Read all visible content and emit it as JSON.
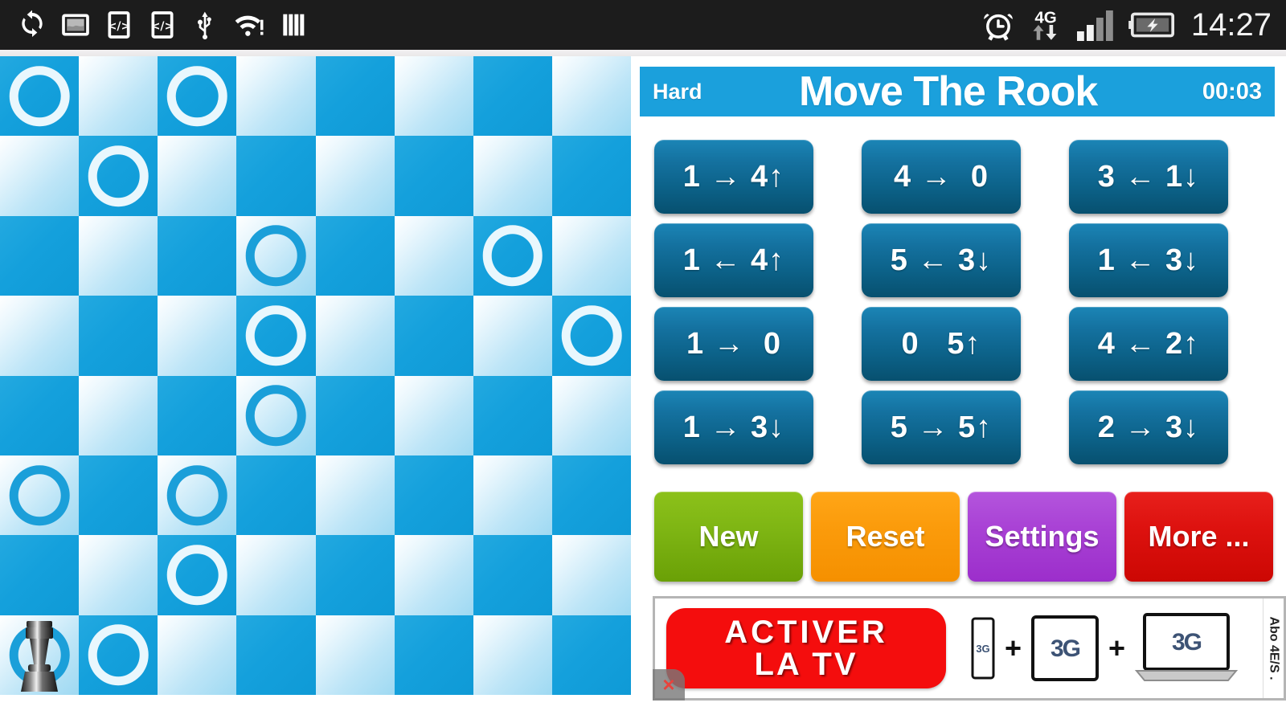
{
  "statusbar": {
    "time": "14:27",
    "left_icons": [
      {
        "name": "sync-icon"
      },
      {
        "name": "screenshot-image-icon"
      },
      {
        "name": "code-tag-icon-1"
      },
      {
        "name": "code-tag-icon-2"
      },
      {
        "name": "usb-icon"
      },
      {
        "name": "wifi-alert-icon"
      },
      {
        "name": "bars-icon"
      }
    ],
    "right_icons": [
      {
        "name": "alarm-clock-icon"
      },
      {
        "name": "network-4g-icon",
        "label": "4G"
      },
      {
        "name": "signal-bars-icon"
      },
      {
        "name": "battery-charging-icon"
      }
    ]
  },
  "game": {
    "difficulty": "Hard",
    "title": "Move The Rook",
    "timer": "00:03",
    "accent_color": "#1ba0dc",
    "board": {
      "columns": 8,
      "rows": 8,
      "dark_color": "#14a0dc",
      "light_color": "#bde5f7",
      "rook_cell": {
        "row": 7,
        "col": 0
      },
      "target_cells": [
        {
          "row": 0,
          "col": 0
        },
        {
          "row": 0,
          "col": 2
        },
        {
          "row": 1,
          "col": 1
        },
        {
          "row": 2,
          "col": 3
        },
        {
          "row": 2,
          "col": 6
        },
        {
          "row": 3,
          "col": 3
        },
        {
          "row": 3,
          "col": 7
        },
        {
          "row": 4,
          "col": 3
        },
        {
          "row": 5,
          "col": 0
        },
        {
          "row": 5,
          "col": 2
        },
        {
          "row": 6,
          "col": 2
        },
        {
          "row": 7,
          "col": 1
        }
      ]
    },
    "moves": [
      {
        "from": "1",
        "arrow": "→",
        "to": "4",
        "updown": "↑",
        "label": "1 → 4↑"
      },
      {
        "from": "4",
        "arrow": "→",
        "to": "0",
        "updown": "",
        "label": "4 →  0"
      },
      {
        "from": "3",
        "arrow": "←",
        "to": "1",
        "updown": "↓",
        "label": "3 ← 1↓"
      },
      {
        "from": "1",
        "arrow": "←",
        "to": "4",
        "updown": "↑",
        "label": "1 ← 4↑"
      },
      {
        "from": "5",
        "arrow": "←",
        "to": "3",
        "updown": "↓",
        "label": "5 ← 3↓"
      },
      {
        "from": "1",
        "arrow": "←",
        "to": "3",
        "updown": "↓",
        "label": "1 ← 3↓"
      },
      {
        "from": "1",
        "arrow": "→",
        "to": "0",
        "updown": "",
        "label": "1 →  0"
      },
      {
        "from": "0",
        "arrow": " ",
        "to": "5",
        "updown": "↑",
        "label": "0   5↑"
      },
      {
        "from": "4",
        "arrow": "←",
        "to": "2",
        "updown": "↑",
        "label": "4 ← 2↑"
      },
      {
        "from": "1",
        "arrow": "→",
        "to": "3",
        "updown": "↓",
        "label": "1 → 3↓"
      },
      {
        "from": "5",
        "arrow": "→",
        "to": "5",
        "updown": "↑",
        "label": "5 → 5↑"
      },
      {
        "from": "2",
        "arrow": "→",
        "to": "3",
        "updown": "↓",
        "label": "2 → 3↓"
      }
    ],
    "actions": [
      {
        "id": "new",
        "label": "New",
        "color": "#7fb614"
      },
      {
        "id": "reset",
        "label": "Reset",
        "color": "#fb9b0b"
      },
      {
        "id": "settings",
        "label": "Settings",
        "color": "#a942d5"
      },
      {
        "id": "more",
        "label": "More ...",
        "color": "#dd120f"
      }
    ]
  },
  "ad": {
    "headline_line1": "ACTIVER",
    "headline_line2": "LA TV",
    "plus1": "+",
    "plus2": "+",
    "logo_phone": "3G",
    "logo_tablet": "3G",
    "logo_laptop": "3G",
    "side_text": "Abo 4E/S .",
    "close_label": "×"
  }
}
